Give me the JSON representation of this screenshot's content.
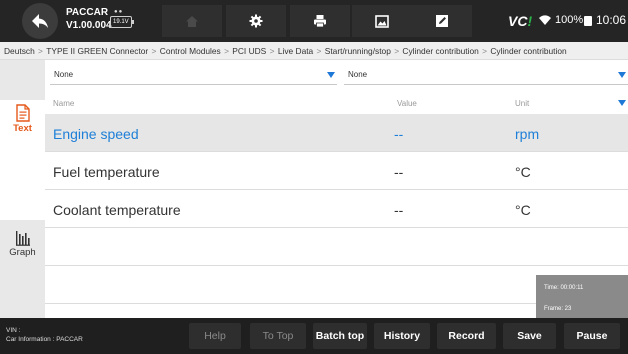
{
  "header": {
    "app_name": "PACCAR",
    "app_version": "V1.00.004",
    "battery_voltage": "19.1V",
    "toolbar_icons": [
      "home-icon",
      "gear-icon",
      "printer-icon",
      "image-icon",
      "edit-icon"
    ],
    "vci_label": "VC",
    "vci_mark": "!",
    "battery_percent": "100%",
    "time": "10:06"
  },
  "breadcrumb": [
    "Deutsch",
    "TYPE II GREEN Connector",
    "Control Modules",
    "PCI UDS",
    "Live Data",
    "Start/running/stop",
    "Cylinder contribution",
    "Cylinder contribution"
  ],
  "sidebar": {
    "tabs": [
      {
        "label": "Text",
        "icon": "document-icon",
        "active": true
      },
      {
        "label": "Graph",
        "icon": "bar-graph-icon",
        "active": false
      }
    ]
  },
  "filters": [
    {
      "value": "None"
    },
    {
      "value": "None"
    }
  ],
  "table": {
    "columns": [
      "Name",
      "Value",
      "Unit"
    ],
    "rows": [
      {
        "name": "Engine speed",
        "value": "--",
        "unit": "rpm",
        "selected": true
      },
      {
        "name": "Fuel temperature",
        "value": "--",
        "unit": "°C",
        "selected": false
      },
      {
        "name": "Coolant temperature",
        "value": "--",
        "unit": "°C",
        "selected": false
      },
      {
        "name": "",
        "value": "",
        "unit": "",
        "selected": false
      },
      {
        "name": "",
        "value": "",
        "unit": "",
        "selected": false
      }
    ]
  },
  "info_overlay": {
    "time_text": "Time:  00:00:11",
    "frame_text": "Frame:  23"
  },
  "footer": {
    "vin_label": "VIN :",
    "car_info": "Car Information : PACCAR",
    "buttons": [
      {
        "label": "Help",
        "enabled": false
      },
      {
        "label": "To Top",
        "enabled": false
      },
      {
        "label": "Batch top",
        "enabled": true
      },
      {
        "label": "History",
        "enabled": true
      },
      {
        "label": "Record",
        "enabled": true
      },
      {
        "label": "Save",
        "enabled": true
      },
      {
        "label": "Pause",
        "enabled": true
      }
    ]
  },
  "colors": {
    "accent_blue": "#1e7fd8",
    "active_tab_orange": "#e5591b",
    "vci_green": "#2db34a",
    "topbar_bg": "#252525"
  }
}
